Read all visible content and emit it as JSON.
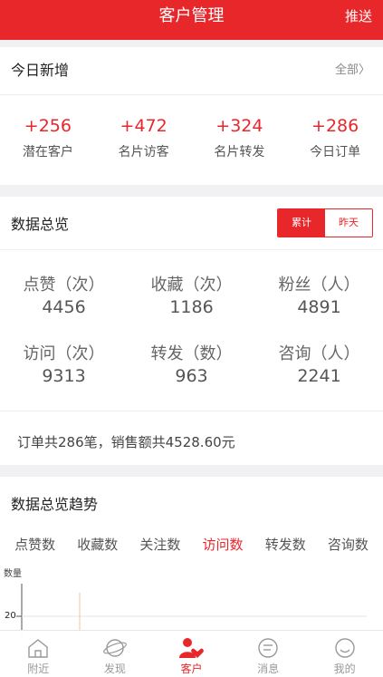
{
  "header": {
    "title": "客户管理",
    "push_label": "推送"
  },
  "today": {
    "title": "今日新增",
    "all_label": "全部〉",
    "items": [
      {
        "value": "+256",
        "label": "潜在客户"
      },
      {
        "value": "+472",
        "label": "名片访客"
      },
      {
        "value": "+324",
        "label": "名片转发"
      },
      {
        "value": "+286",
        "label": "今日订单"
      }
    ]
  },
  "overview": {
    "title": "数据总览",
    "toggle": {
      "cumulative": "累计",
      "yesterday": "昨天",
      "selected": "累计"
    },
    "stats": [
      {
        "label": "点赞（次）",
        "value": "4456"
      },
      {
        "label": "收藏（次）",
        "value": "1186"
      },
      {
        "label": "粉丝（人）",
        "value": "4891"
      },
      {
        "label": "访问（次）",
        "value": "9313"
      },
      {
        "label": "转发（数）",
        "value": "963"
      },
      {
        "label": "咨询（人）",
        "value": "2241"
      }
    ],
    "orders_summary": "订单共286笔，销售额共4528.60元"
  },
  "trend": {
    "title": "数据总览趋势",
    "tabs": [
      "点赞数",
      "收藏数",
      "关注数",
      "访问数",
      "转发数",
      "咨询数"
    ],
    "active_tab": "访问数",
    "y_axis_label": "数量",
    "y_tick": "20"
  },
  "tabbar": {
    "items": [
      {
        "label": "附近",
        "icon": "nearby-icon"
      },
      {
        "label": "发现",
        "icon": "discover-icon"
      },
      {
        "label": "客户",
        "icon": "customer-icon"
      },
      {
        "label": "消息",
        "icon": "message-icon"
      },
      {
        "label": "我的",
        "icon": "profile-icon"
      }
    ],
    "active": "客户"
  },
  "colors": {
    "accent": "#e8272b",
    "background": "#f1f1f3"
  }
}
